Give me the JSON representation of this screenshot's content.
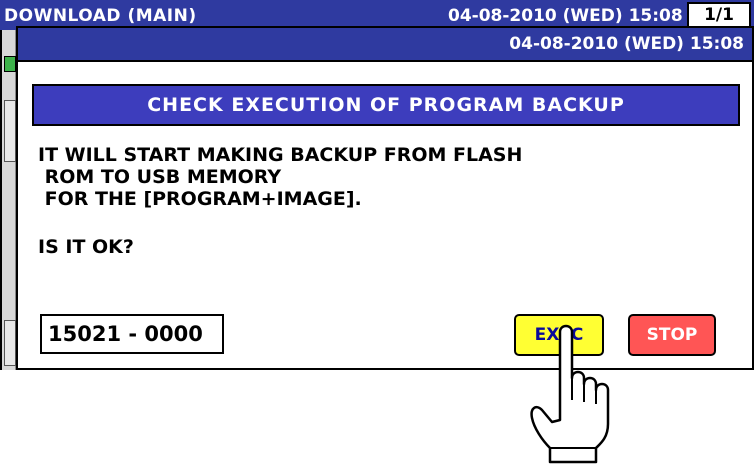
{
  "background_window": {
    "title": "DOWNLOAD (MAIN)",
    "datetime": "04-08-2010 (WED)  15:08",
    "page_indicator": "1/1"
  },
  "dialog": {
    "datetime": "04-08-2010 (WED)  15:08",
    "heading": "CHECK EXECUTION OF PROGRAM BACKUP",
    "message_lines": [
      "IT WILL START MAKING BACKUP FROM FLASH",
      " ROM TO USB MEMORY",
      " FOR THE [PROGRAM+IMAGE]."
    ],
    "question": "IS IT OK?",
    "code": "15021 - 0000",
    "exec_label": "EXEC",
    "stop_label": "STOP"
  },
  "colors": {
    "title_bar": "#2f3aa0",
    "heading_bar": "#3d3dbd",
    "exec_button": "#ffff33",
    "stop_button": "#ff5555"
  },
  "icons": {
    "pointer": "hand-pointer-icon"
  }
}
